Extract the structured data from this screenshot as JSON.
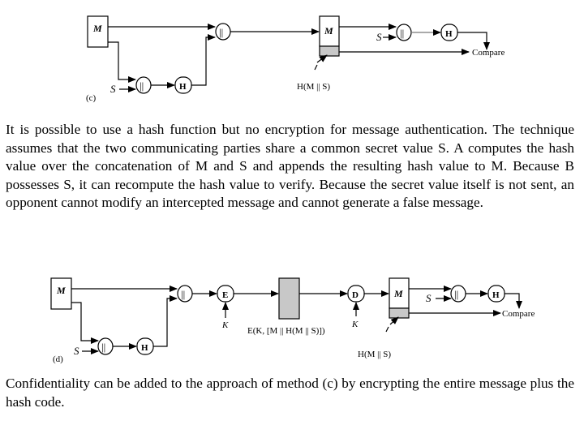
{
  "diagram_c": {
    "label": "(c)",
    "message": "M",
    "secret": "S",
    "concat_symbol": "||",
    "hash": "H",
    "received_message": "M",
    "receiver_secret": "S",
    "receiver_hash": "H",
    "compare": "Compare",
    "hash_value_label": "H(M || S)"
  },
  "paragraph_1": "It is possible to use a hash function but no encryption for message authentication. The technique assumes that the two communicating parties share a common secret value S. A computes the hash value over the concatenation of M and S and appends the resulting hash value to M. Because B possesses S, it can recompute the hash value to verify. Because the secret value itself is not sent, an opponent cannot modify an intercepted message and cannot generate a false message.",
  "diagram_d": {
    "label": "(d)",
    "message": "M",
    "secret": "S",
    "concat_symbol": "||",
    "hash": "H",
    "encrypt": "E",
    "key_enc": "K",
    "ciphertext_label": "E(K, [M || H(M || S)])",
    "decrypt": "D",
    "key_dec": "K",
    "received_message": "M",
    "receiver_secret": "S",
    "receiver_hash": "H",
    "compare": "Compare",
    "hash_value_label": "H(M || S)"
  },
  "paragraph_2": "Confidentiality can be added to the approach of method (c) by encrypting the entire message plus the hash code.",
  "colors": {
    "shaded_block": "#c8c8c8",
    "line": "#000000",
    "background": "#ffffff"
  }
}
